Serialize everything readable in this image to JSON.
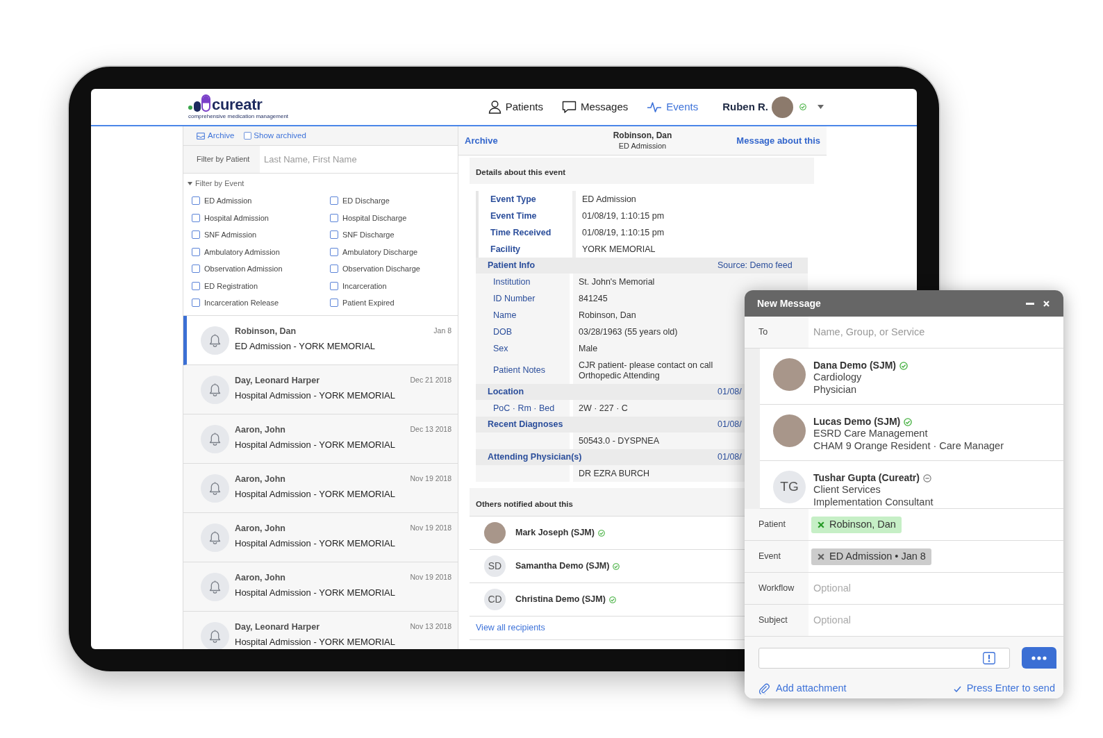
{
  "header": {
    "logo": {
      "wordmark": "cureatr",
      "tagline": "comprehensive medication management"
    },
    "nav": [
      {
        "kind": "patients",
        "label": "Patients",
        "selected": false
      },
      {
        "kind": "messages",
        "label": "Messages",
        "selected": false
      },
      {
        "kind": "events",
        "label": "Events",
        "selected": true
      }
    ],
    "user": {
      "name": "Ruben R.",
      "available": true
    }
  },
  "sidebar": {
    "archive": "Archive",
    "show_archived": {
      "label": "Show archived",
      "checked": false
    },
    "patient_filter": {
      "label": "Filter by Patient",
      "placeholder": "Last Name, First Name"
    },
    "event_filter": {
      "label": "Filter by Event",
      "expanded": true,
      "options": [
        {
          "label": "ED Admission",
          "checked": false
        },
        {
          "label": "ED Discharge",
          "checked": false
        },
        {
          "label": "Hospital Admission",
          "checked": false
        },
        {
          "label": "Hospital Discharge",
          "checked": false
        },
        {
          "label": "SNF Admission",
          "checked": false
        },
        {
          "label": "SNF Discharge",
          "checked": false
        },
        {
          "label": "Ambulatory Admission",
          "checked": false
        },
        {
          "label": "Ambulatory Discharge",
          "checked": false
        },
        {
          "label": "Observation Admission",
          "checked": false
        },
        {
          "label": "Observation Discharge",
          "checked": false
        },
        {
          "label": "ED Registration",
          "checked": false
        },
        {
          "label": "Incarceration",
          "checked": false
        },
        {
          "label": "Incarceration Release",
          "checked": false
        },
        {
          "label": "Patient Expired",
          "checked": false
        }
      ]
    },
    "events": [
      {
        "patient": "Robinson, Dan",
        "description": "ED Admission - YORK MEMORIAL",
        "date": "Jan 8",
        "selected": true
      },
      {
        "patient": "Day, Leonard Harper",
        "description": "Hospital Admission - YORK MEMORIAL",
        "date": "Dec 21 2018",
        "selected": false
      },
      {
        "patient": "Aaron, John",
        "description": "Hospital Admission - YORK MEMORIAL",
        "date": "Dec 13 2018",
        "selected": false
      },
      {
        "patient": "Aaron, John",
        "description": "Hospital Admission - YORK MEMORIAL",
        "date": "Nov 19 2018",
        "selected": false
      },
      {
        "patient": "Aaron, John",
        "description": "Hospital Admission - YORK MEMORIAL",
        "date": "Nov 19 2018",
        "selected": false
      },
      {
        "patient": "Aaron, John",
        "description": "Hospital Admission - YORK MEMORIAL",
        "date": "Nov 19 2018",
        "selected": false
      },
      {
        "patient": "Day, Leonard Harper",
        "description": "Hospital Admission - YORK MEMORIAL",
        "date": "Nov 13 2018",
        "selected": false
      }
    ]
  },
  "event_detail": {
    "archive": "Archive",
    "patient": "Robinson, Dan",
    "event_type": "ED Admission",
    "message_link": "Message about this",
    "details_title": "Details about this event",
    "fields": [
      {
        "label": "Event Type",
        "value": "ED Admission"
      },
      {
        "label": "Event Time",
        "value": "01/08/19, 1:10:15 pm"
      },
      {
        "label": "Time Received",
        "value": "01/08/19, 1:10:15 pm"
      },
      {
        "label": "Facility",
        "value": "YORK MEMORIAL"
      }
    ],
    "sections": [
      {
        "title": "Patient Info",
        "note": "Source: Demo feed",
        "rows": [
          {
            "label": "Institution",
            "value": "St. John's Memorial"
          },
          {
            "label": "ID Number",
            "value": "841245"
          },
          {
            "label": "Name",
            "value": "Robinson, Dan"
          },
          {
            "label": "DOB",
            "value": "03/28/1963 (55 years old)"
          },
          {
            "label": "Sex",
            "value": "Male"
          },
          {
            "label": "Patient Notes",
            "value": "CJR patient- please contact on call\nOrthopedic Attending"
          }
        ]
      },
      {
        "title": "Location",
        "note": "01/08/",
        "rows": [
          {
            "label": "PoC · Rm · Bed",
            "value": "2W · 227 · C"
          }
        ]
      },
      {
        "title": "Recent Diagnoses",
        "note": "01/08/",
        "rows": [
          {
            "value": "50543.0 - DYSPNEA"
          }
        ]
      },
      {
        "title": "Attending Physician(s)",
        "note": "01/08/",
        "rows": [
          {
            "value": "DR EZRA BURCH"
          }
        ]
      }
    ],
    "notified": {
      "title": "Others notified about this",
      "people": [
        {
          "name": "Mark Joseph (SJM)",
          "kind": "photo",
          "available": true
        },
        {
          "name": "Samantha Demo (SJM)",
          "kind": "initials",
          "initials": "SD",
          "available": true
        },
        {
          "name": "Christina Demo (SJM)",
          "kind": "initials",
          "initials": "CD",
          "available": true
        }
      ],
      "view_all": "View all recipients"
    }
  },
  "new_message": {
    "title": "New Message",
    "to": {
      "label": "To",
      "placeholder": "Name, Group, or Service"
    },
    "suggestions": [
      {
        "name": "Dana Demo (SJM)",
        "kind": "photo",
        "available": true,
        "lines": [
          "Cardiology",
          "Physician"
        ]
      },
      {
        "name": "Lucas Demo (SJM)",
        "kind": "photo",
        "available": true,
        "lines": [
          "ESRD Care Management",
          "CHAM 9 Orange Resident · Care Manager"
        ]
      },
      {
        "name": "Tushar Gupta (Cureatr)",
        "kind": "initials",
        "initials": "TG",
        "available": false,
        "lines": [
          "Client Services",
          "Implementation Consultant"
        ]
      }
    ],
    "fields": [
      {
        "label": "Patient",
        "kind": "chip",
        "chip": "Robinson, Dan",
        "color": "#c6efc6"
      },
      {
        "label": "Event",
        "kind": "chip",
        "chip": "ED Admission • Jan 8",
        "color": "#cccccc"
      },
      {
        "label": "Workflow",
        "kind": "input",
        "placeholder": "Optional"
      },
      {
        "label": "Subject",
        "kind": "input",
        "placeholder": "Optional"
      }
    ],
    "attachment": "Add attachment",
    "send_hint": "Press Enter to send"
  }
}
